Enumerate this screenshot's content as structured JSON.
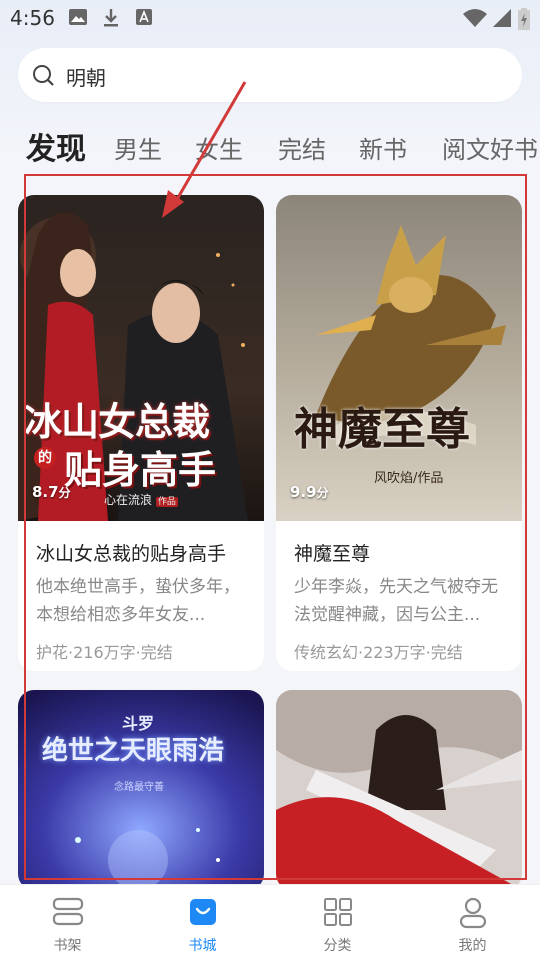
{
  "status_bar": {
    "time": "4:56"
  },
  "search": {
    "query": "明朝"
  },
  "tabs": [
    {
      "label": "发现",
      "active": true
    },
    {
      "label": "男生",
      "active": false
    },
    {
      "label": "女生",
      "active": false
    },
    {
      "label": "完结",
      "active": false
    },
    {
      "label": "新书",
      "active": false
    },
    {
      "label": "阅文好书",
      "active": false
    }
  ],
  "books": [
    {
      "cover_title": "冰山女总裁",
      "cover_subtitle_small": "的",
      "cover_subtitle": "贴身高手",
      "cover_author": "心在流浪",
      "cover_author_tag": "作品",
      "score": "8.7",
      "score_unit": "分",
      "title": "冰山女总裁的贴身高手",
      "description": "他本绝世高手，蛰伏多年，本想给相恋多年女友...",
      "meta": "护花·216万字·完结"
    },
    {
      "cover_title": "神魔至尊",
      "cover_author": "风吹焰/作品",
      "score": "9.9",
      "score_unit": "分",
      "title": "神魔至尊",
      "description": "少年李焱，先天之气被夺无法觉醒神藏，因与公主...",
      "meta": "传统玄幻·223万字·完结"
    },
    {
      "cover_top": "斗罗",
      "cover_title": "绝世之天眼雨浩",
      "cover_author": "念路最守善"
    },
    {
      "cover_title": ""
    }
  ],
  "bottom_nav": [
    {
      "label": "书架",
      "icon": "bookshelf-icon",
      "active": false
    },
    {
      "label": "书城",
      "icon": "bookstore-bag-icon",
      "active": true
    },
    {
      "label": "分类",
      "icon": "category-grid-icon",
      "active": false
    },
    {
      "label": "我的",
      "icon": "user-profile-icon",
      "active": false
    }
  ],
  "colors": {
    "accent": "#1e88f5",
    "highlight_box": "#d23a3a"
  }
}
